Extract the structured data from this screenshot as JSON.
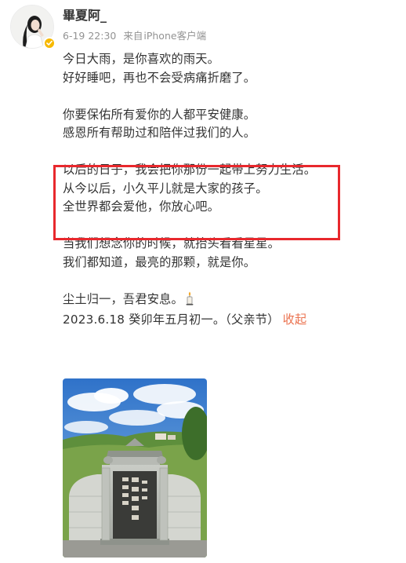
{
  "post": {
    "author": {
      "name": "畢夏阿_",
      "avatar_icon": "avatar-portrait",
      "verified_icon": "verified-badge-icon",
      "verified_color": "#f7b900"
    },
    "meta": {
      "time": "6-19 22:30",
      "source_prefix": "来自",
      "source": "iPhone客户端"
    },
    "paragraphs": [
      [
        "今日大雨，是你喜欢的雨天。",
        "好好睡吧，再也不会受病痛折磨了。"
      ],
      [
        "你要保佑所有爱你的人都平安健康。",
        "感恩所有帮助过和陪伴过我们的人。"
      ],
      [
        "以后的日子，我会把你那份一起带上努力生活。",
        "从今以后，小久平儿就是大家的孩子。",
        "全世界都会爱他，你放心吧。"
      ],
      [
        "当我们想念你的时候，就抬头看看星星。",
        "我们都知道，最亮的那颗，就是你。"
      ]
    ],
    "closing": {
      "line1": "尘土归一，吾君安息。",
      "line1_icon": "candle-icon",
      "line2": "2023.6.18 癸卯年五月初一。（父亲节）",
      "collapse_label": "收起"
    },
    "highlight_color": "#e8282d",
    "link_color": "#eb7350",
    "image": {
      "subject": "tombstone-photo",
      "inscription": "大君张恒之墓"
    }
  }
}
